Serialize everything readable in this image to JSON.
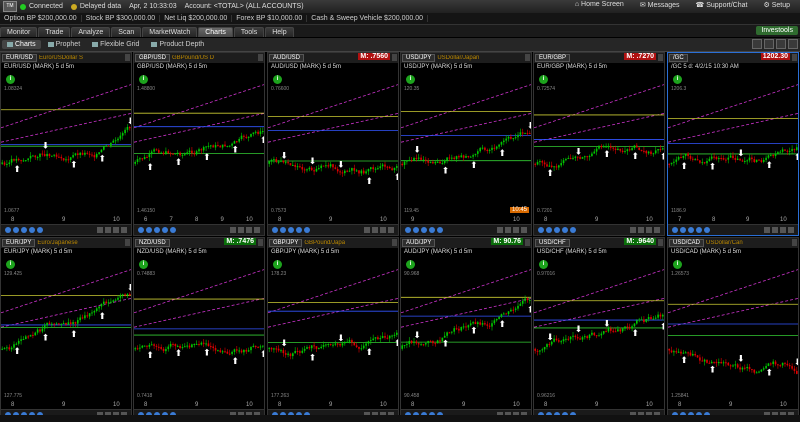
{
  "topbar": {
    "logo": "TM",
    "connected": "Connected",
    "delayed": "Delayed data",
    "datetime": "Apr, 2   10:33:03",
    "account": "Account: <TOTAL> (ALL ACCOUNTS)",
    "home": "Home Screen",
    "messages": "Messages",
    "support": "Support/Chat",
    "setup": "Setup"
  },
  "balances": [
    "Option BP  $200,000.00",
    "Stock BP  $300,000.00",
    "Net Liq  $200,000.00",
    "Forex BP  $10,000.00",
    "Cash & Sweep Vehicle  $200,000.00"
  ],
  "tabs": [
    "Monitor",
    "Trade",
    "Analyze",
    "Scan",
    "MarketWatch",
    "Charts",
    "Tools",
    "Help"
  ],
  "active_tab": "Charts",
  "investools": "Investools",
  "subtabs": [
    "Charts",
    "Prophet",
    "Flexible Grid",
    "Product Depth"
  ],
  "colors": {
    "up": "#00c800",
    "down": "#e00000",
    "accent": "#2a6fd6",
    "level_yellow": "#cccc33",
    "level_green": "#33cc33",
    "level_blue": "#3355ff",
    "channel": "#cc33cc"
  },
  "panels": [
    {
      "sym": "EUR/USD",
      "desc": "Euro/USDollar S",
      "mark": "",
      "title": "EUR/USD (MARK) 5 d 5m",
      "top_level": "1.08324",
      "bottom_level": "1.0677",
      "x": [
        "8",
        "9",
        "10"
      ]
    },
    {
      "sym": "GBP/USD",
      "desc": "GBPound/US D",
      "mark": "",
      "title": "GBP/USD (MARK) 5 d 5m",
      "top_level": "1.48800",
      "bottom_level": "1.46150",
      "x": [
        "6",
        "7",
        "8",
        "9",
        "10"
      ]
    },
    {
      "sym": "AUD/USD",
      "desc": "",
      "mark": "M: .7560",
      "dir": "down",
      "title": "AUD/USD (MARK) 5 d 5m",
      "top_level": "0.76600",
      "bottom_level": "0.7573",
      "x": [
        "8",
        "9",
        "10"
      ]
    },
    {
      "sym": "USD/JPY",
      "desc": "USDollar/Japan",
      "mark": "",
      "title": "USD/JPY (MARK) 5 d 5m",
      "top_level": "120.35",
      "bottom_level": "119.45",
      "x": [
        "9",
        "10"
      ],
      "clock": "10:45"
    },
    {
      "sym": "EUR/GBP",
      "desc": "",
      "mark": "M: .7270",
      "dir": "down",
      "title": "EUR/GBP (MARK) 5 d 5m",
      "top_level": "0.72574",
      "bottom_level": "0.7201",
      "x": [
        "8",
        "9",
        "10"
      ]
    },
    {
      "sym": "/GC",
      "desc": "",
      "mark": "1202.30",
      "dir": "down",
      "title": "/GC 5 d: 4/2/15 10:30 AM",
      "top_level": "1206.3",
      "bottom_level": "1186.9",
      "x": [
        "7",
        "8",
        "9",
        "10"
      ]
    },
    {
      "sym": "EUR/JPY",
      "desc": "Euro/Japanese",
      "mark": "",
      "title": "EUR/JPY (MARK) 5 d 5m",
      "top_level": "129.425",
      "bottom_level": "127.775",
      "x": [
        "8",
        "9",
        "10"
      ]
    },
    {
      "sym": "NZD/USD",
      "desc": "",
      "mark": "M: .7476",
      "dir": "up",
      "title": "NZD/USD (MARK) 5 d 5m",
      "top_level": "0.74883",
      "bottom_level": "0.7418",
      "x": [
        "8",
        "9",
        "10"
      ]
    },
    {
      "sym": "GBP/JPY",
      "desc": "GBPound/Japa",
      "mark": "",
      "title": "GBP/JPY (MARK) 5 d 5m",
      "top_level": "178.23",
      "bottom_level": "177.263",
      "x": [
        "8",
        "9",
        "10"
      ]
    },
    {
      "sym": "AUD/JPY",
      "desc": "",
      "mark": "M: 90.76",
      "dir": "up",
      "title": "AUD/JPY (MARK) 5 d 5m",
      "top_level": "90.968",
      "bottom_level": "90.458",
      "x": [
        "8",
        "9",
        "10"
      ]
    },
    {
      "sym": "USD/CHF",
      "desc": "",
      "mark": "M: .9640",
      "dir": "up",
      "title": "USD/CHF (MARK) 5 d 5m",
      "top_level": "0.97016",
      "bottom_level": "0.96216",
      "x": [
        "8",
        "9",
        "10"
      ]
    },
    {
      "sym": "USD/CAD",
      "desc": "USDollar/Can",
      "mark": "",
      "title": "USD/CAD (MARK) 5 d 5m",
      "top_level": "1.26573",
      "bottom_level": "1.25841",
      "x": [
        "8",
        "9",
        "10"
      ]
    }
  ]
}
